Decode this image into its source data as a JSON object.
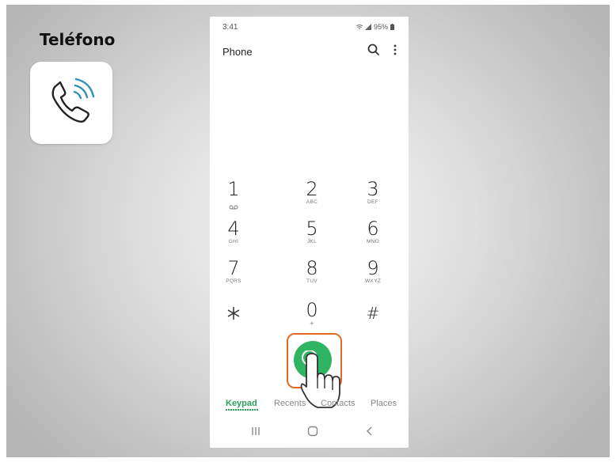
{
  "slide": {
    "heading": "Teléfono",
    "app_icon": "phone-ringing-icon"
  },
  "phone": {
    "status": {
      "time": "3:41",
      "battery": "95%"
    },
    "app_title": "Phone",
    "keypad": [
      {
        "num": "1",
        "sub": "voicemail"
      },
      {
        "num": "2",
        "sub": "ABC"
      },
      {
        "num": "3",
        "sub": "DEF"
      },
      {
        "num": "4",
        "sub": "GHI"
      },
      {
        "num": "5",
        "sub": "JKL"
      },
      {
        "num": "6",
        "sub": "MNO"
      },
      {
        "num": "7",
        "sub": "PQRS"
      },
      {
        "num": "8",
        "sub": "TUV"
      },
      {
        "num": "9",
        "sub": "WXYZ"
      },
      {
        "num": "*",
        "sub": ""
      },
      {
        "num": "0",
        "sub": "+"
      },
      {
        "num": "#",
        "sub": ""
      }
    ],
    "tabs": [
      "Keypad",
      "Recents",
      "Contacts",
      "Places"
    ],
    "active_tab": "Keypad",
    "accent_color": "#2fb562",
    "highlight_color": "#e06a22"
  }
}
